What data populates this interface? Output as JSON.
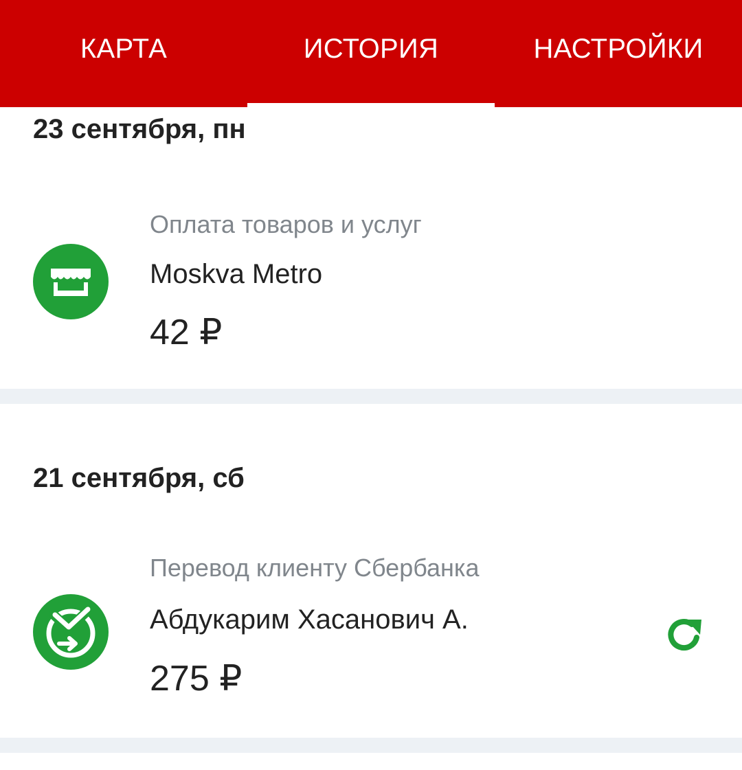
{
  "tabs": [
    {
      "label": "КАРТА",
      "active": false
    },
    {
      "label": "ИСТОРИЯ",
      "active": true
    },
    {
      "label": "НАСТРОЙКИ",
      "active": false
    }
  ],
  "history": [
    {
      "date": "23 сентября, пн",
      "transaction": {
        "category": "Оплата товаров и услуг",
        "name": "Moskva Metro",
        "amount": "42 ₽",
        "icon": "store-icon"
      }
    },
    {
      "date": "21 сентября, сб",
      "transaction": {
        "category": "Перевод клиенту Сбербанка",
        "name": "Абдукарим Хасанович А.",
        "amount": "275 ₽",
        "icon": "sber-transfer-icon",
        "action_icon": "repeat-icon"
      }
    }
  ],
  "colors": {
    "brand_red": "#cc0000",
    "accent_green": "#21a038",
    "separator": "#edf1f5"
  }
}
